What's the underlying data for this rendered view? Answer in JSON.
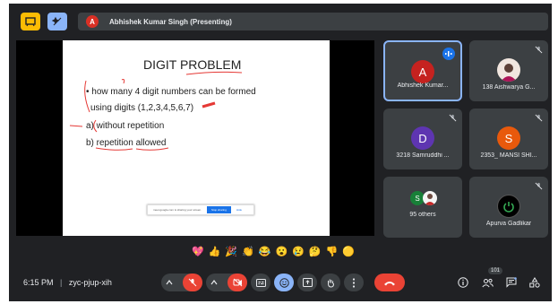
{
  "presenter": {
    "initial": "A",
    "label": "Abhishek Kumar Singh (Presenting)"
  },
  "slide": {
    "title": "DIGIT PROBLEM",
    "line1": "how many 4 digit numbers can be formed",
    "line2": "using digits (1,2,3,4,5,6,7)",
    "line3": "a) without repetition",
    "line4": "b) repetition allowed"
  },
  "share_banner": {
    "text": "meet.google.com is sharing your screen.",
    "stop": "Stop sharing",
    "hide": "Hide"
  },
  "tiles": [
    {
      "initial": "A",
      "name": "Abhishek Kumar...",
      "color": "#c5221f"
    },
    {
      "name": "138 Aishwarya G..."
    },
    {
      "initial": "D",
      "name": "3218 Samruddhi ...",
      "color": "#5e35b1"
    },
    {
      "initial": "S",
      "name": "2353_ MANSI SHI...",
      "color": "#e8590c"
    },
    {
      "initial": "S",
      "name": "95 others",
      "color": "#188038"
    },
    {
      "name": "Apurva Gadlikar"
    }
  ],
  "reactions": [
    "💖",
    "👍",
    "🎉",
    "👏",
    "😂",
    "😮",
    "😢",
    "🤔",
    "👎",
    "🟡"
  ],
  "bottom": {
    "time": "6:15 PM",
    "separator": "|",
    "meeting_code": "zyc-pjup-xih",
    "participant_count": "101"
  }
}
